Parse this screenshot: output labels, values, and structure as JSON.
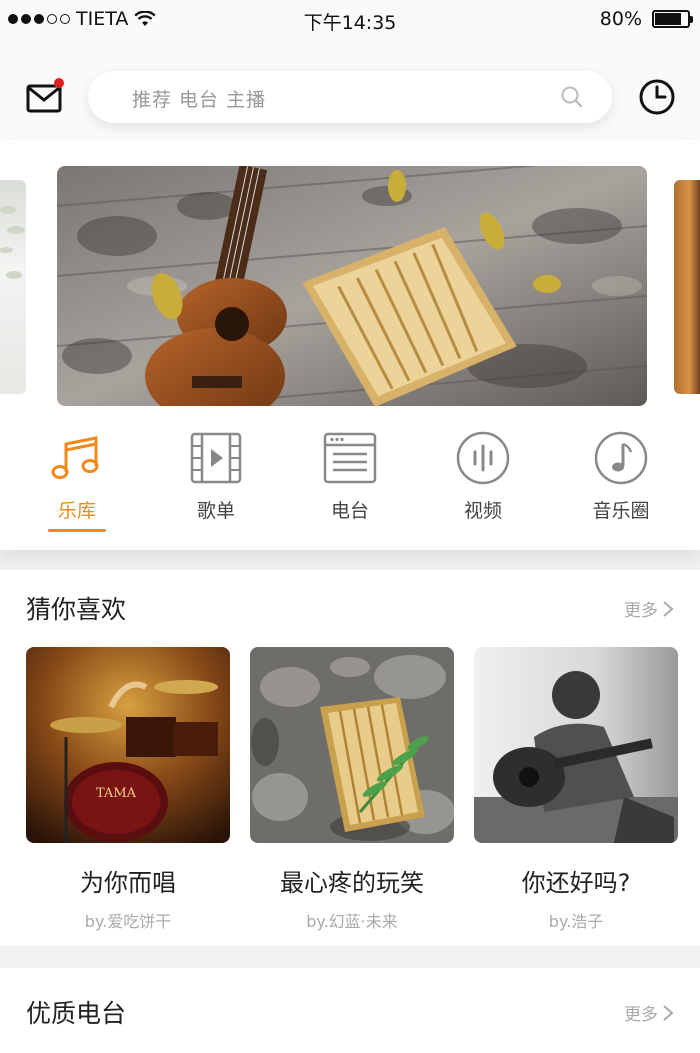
{
  "status_bar": {
    "carrier": "TIETA",
    "time": "下午14:35",
    "battery": "80%",
    "battery_level": 0.8
  },
  "header": {
    "mail_icon": "mail-icon",
    "search_placeholder": "推荐 电台 主播",
    "search_icon": "search-icon",
    "history_icon": "clock-icon"
  },
  "nav": {
    "items": [
      {
        "label": "乐库",
        "icon": "music-note-icon",
        "active": true
      },
      {
        "label": "歌单",
        "icon": "video-film-icon",
        "active": false
      },
      {
        "label": "电台",
        "icon": "radio-icon",
        "active": false
      },
      {
        "label": "视频",
        "icon": "sound-wave-icon",
        "active": false
      },
      {
        "label": "音乐圈",
        "icon": "note-circle-icon",
        "active": false
      }
    ]
  },
  "guess_section": {
    "title": "猜你喜欢",
    "more": "更多",
    "cards": [
      {
        "title": "为你而唱",
        "author": "by.爱吃饼干"
      },
      {
        "title": "最心疼的玩笑",
        "author": "by.幻蓝·未来"
      },
      {
        "title": "你还好吗?",
        "author": "by.浩子"
      }
    ]
  },
  "radio_section": {
    "title": "优质电台",
    "more": "更多"
  },
  "colors": {
    "accent": "#f08a1c",
    "unread_dot": "#e02020"
  }
}
